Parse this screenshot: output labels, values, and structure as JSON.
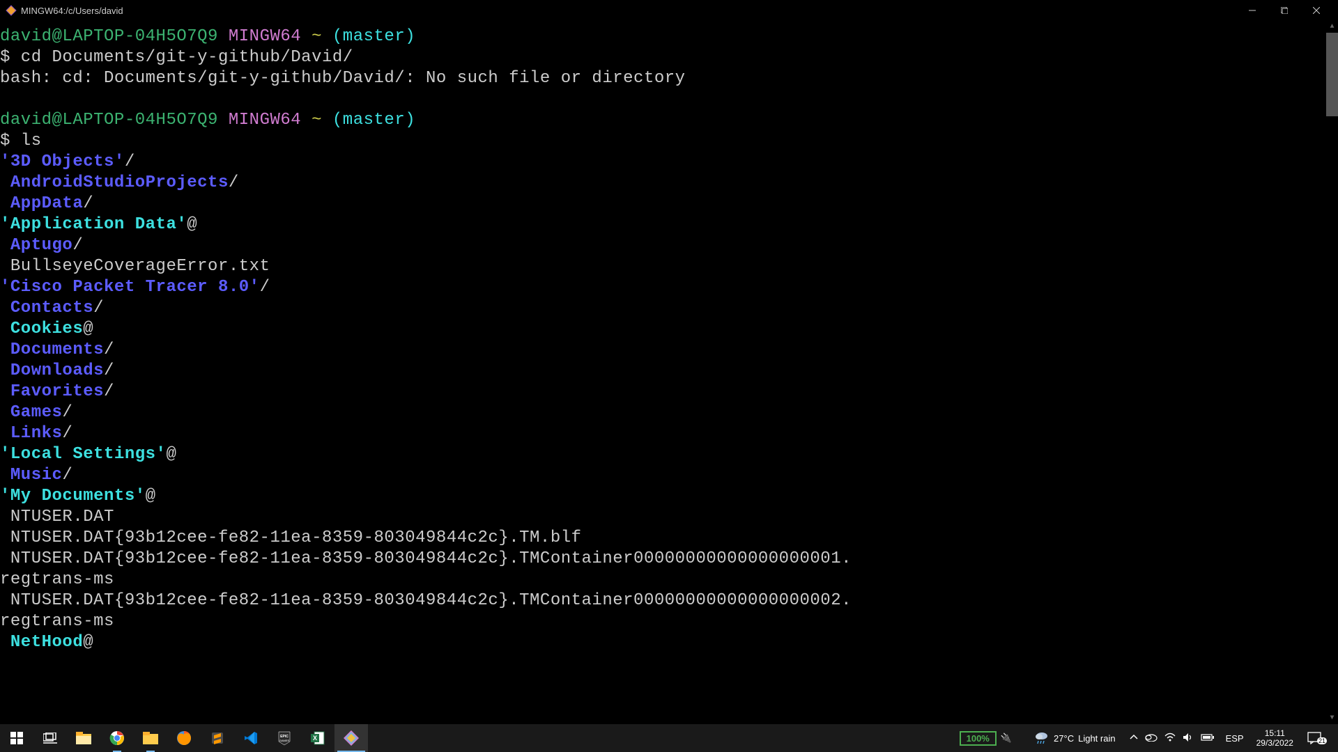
{
  "window": {
    "title": "MINGW64:/c/Users/david"
  },
  "prompt": {
    "user_host": "david@LAPTOP-04H5O7Q9",
    "system": "MINGW64",
    "path": "~",
    "branch": "(master)"
  },
  "session": [
    {
      "type": "cmd",
      "text": "cd Documents/git-y-github/David/"
    },
    {
      "type": "out",
      "text": "bash: cd: Documents/git-y-github/David/: No such file or directory"
    },
    {
      "type": "blank"
    },
    {
      "type": "prompt"
    },
    {
      "type": "cmd",
      "text": "ls"
    }
  ],
  "ls": [
    {
      "name": "'3D Objects'",
      "kind": "dir",
      "suffix": "/"
    },
    {
      "name": " AndroidStudioProjects",
      "kind": "dir",
      "suffix": "/"
    },
    {
      "name": " AppData",
      "kind": "dir",
      "suffix": "/"
    },
    {
      "name": "'Application Data'",
      "kind": "symlink",
      "suffix": "@"
    },
    {
      "name": " Aptugo",
      "kind": "dir",
      "suffix": "/"
    },
    {
      "name": " BullseyeCoverageError.txt",
      "kind": "file",
      "suffix": ""
    },
    {
      "name": "'Cisco Packet Tracer 8.0'",
      "kind": "dir",
      "suffix": "/"
    },
    {
      "name": " Contacts",
      "kind": "dir",
      "suffix": "/"
    },
    {
      "name": " Cookies",
      "kind": "symlink",
      "suffix": "@"
    },
    {
      "name": " Documents",
      "kind": "dir",
      "suffix": "/"
    },
    {
      "name": " Downloads",
      "kind": "dir",
      "suffix": "/"
    },
    {
      "name": " Favorites",
      "kind": "dir",
      "suffix": "/"
    },
    {
      "name": " Games",
      "kind": "dir",
      "suffix": "/"
    },
    {
      "name": " Links",
      "kind": "dir",
      "suffix": "/"
    },
    {
      "name": "'Local Settings'",
      "kind": "symlink",
      "suffix": "@"
    },
    {
      "name": " Music",
      "kind": "dir",
      "suffix": "/"
    },
    {
      "name": "'My Documents'",
      "kind": "symlink",
      "suffix": "@"
    },
    {
      "name": " NTUSER.DAT",
      "kind": "file",
      "suffix": ""
    },
    {
      "name": " NTUSER.DAT{93b12cee-fe82-11ea-8359-803049844c2c}.TM.blf",
      "kind": "file",
      "suffix": ""
    },
    {
      "name": " NTUSER.DAT{93b12cee-fe82-11ea-8359-803049844c2c}.TMContainer00000000000000000001.regtrans-ms",
      "kind": "file",
      "suffix": "",
      "wrap": 82
    },
    {
      "name": " NTUSER.DAT{93b12cee-fe82-11ea-8359-803049844c2c}.TMContainer00000000000000000002.regtrans-ms",
      "kind": "file",
      "suffix": "",
      "wrap": 82
    },
    {
      "name": " NetHood",
      "kind": "symlink",
      "suffix": "@"
    }
  ],
  "taskbar": {
    "battery": "100%",
    "weather_temp": "27°C",
    "weather_text": "Light rain",
    "lang": "ESP",
    "time": "15:11",
    "date": "29/3/2022",
    "notif_count": "21"
  }
}
